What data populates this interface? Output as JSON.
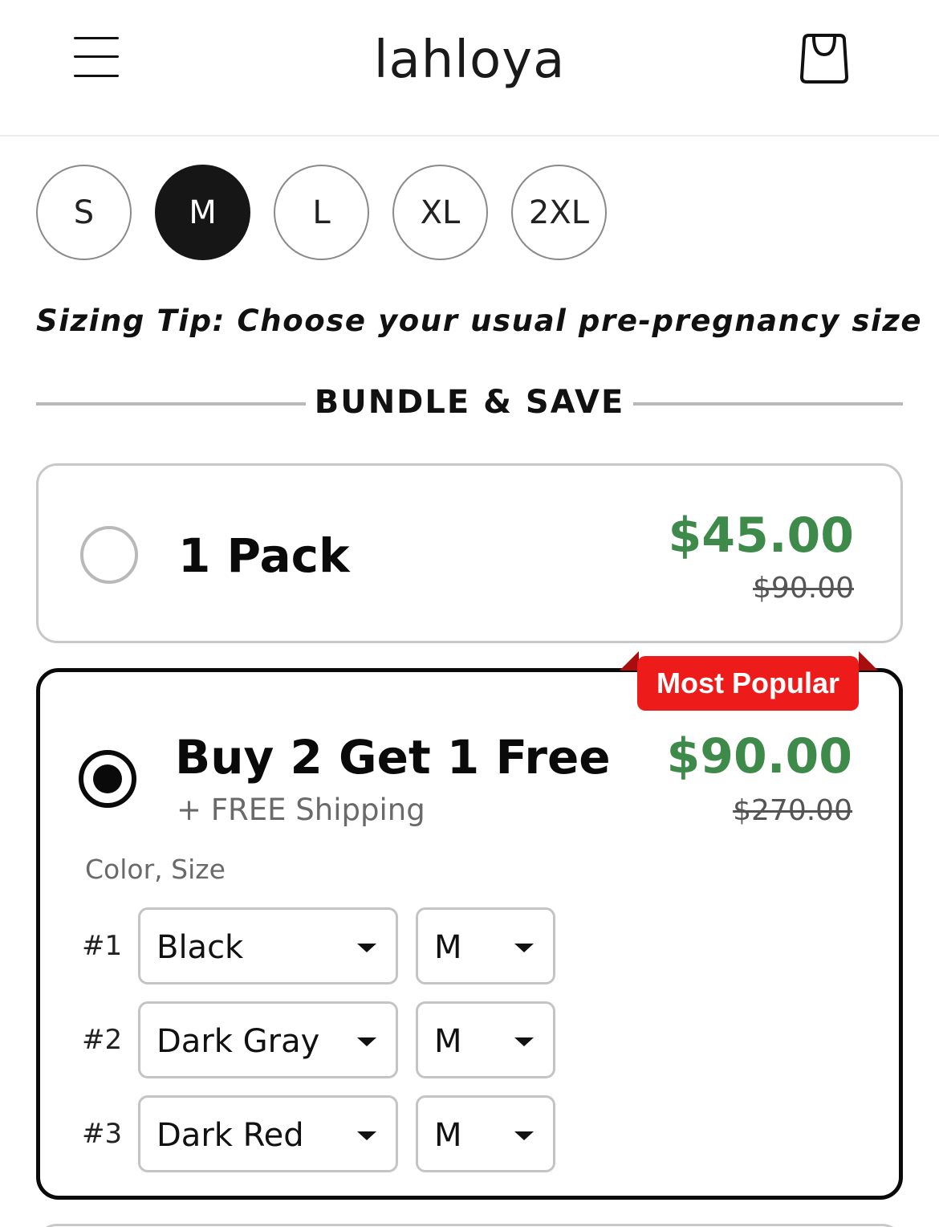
{
  "header": {
    "logo": "lahloya",
    "menu_icon": "hamburger-menu-icon",
    "cart_icon": "shopping-bag-icon"
  },
  "sizes": {
    "options": [
      "S",
      "M",
      "L",
      "XL",
      "2XL"
    ],
    "selected": "M"
  },
  "sizing_tip": "Sizing Tip: Choose your usual pre-pregnancy size",
  "bundle": {
    "heading": "BUNDLE & SAVE",
    "offers": [
      {
        "title": "1 Pack",
        "price": "$45.00",
        "old_price": "$90.00",
        "selected": false
      },
      {
        "title": "Buy 2 Get 1 Free",
        "subtitle": "+ FREE Shipping",
        "price": "$90.00",
        "old_price": "$270.00",
        "badge": "Most Popular",
        "selected": true,
        "variant_label": "Color, Size",
        "variants": [
          {
            "num": "#1",
            "color": "Black",
            "size": "M"
          },
          {
            "num": "#2",
            "color": "Dark Gray",
            "size": "M"
          },
          {
            "num": "#3",
            "color": "Dark Red",
            "size": "M"
          }
        ]
      }
    ]
  },
  "colors": {
    "price_green": "#3e8a4a",
    "badge_red": "#ee1b1b",
    "selected_size_bg": "#161616"
  }
}
